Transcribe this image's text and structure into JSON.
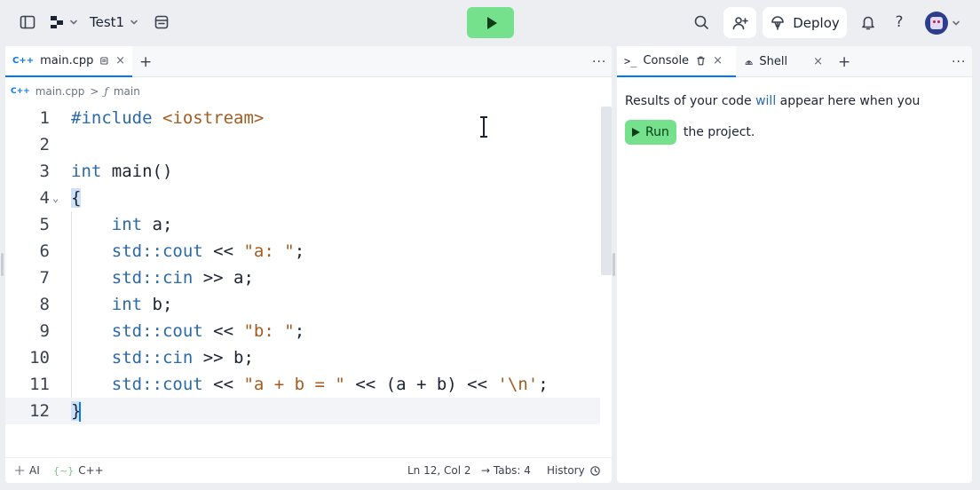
{
  "topbar": {
    "project_name": "Test1",
    "deploy_label": "Deploy",
    "help_label": "?"
  },
  "editor": {
    "tab_label": "main.cpp",
    "tab_close": "×",
    "add_tab": "+",
    "more": "···",
    "breadcrumb_file": "main.cpp",
    "breadcrumb_sep": ">",
    "breadcrumb_symbol_icon": "ƒ",
    "breadcrumb_symbol": "main",
    "lines": [
      {
        "n": "1",
        "parts": [
          [
            "kw",
            "#include"
          ],
          [
            "",
            " "
          ],
          [
            "str",
            "<iostream>"
          ]
        ]
      },
      {
        "n": "2",
        "parts": []
      },
      {
        "n": "3",
        "parts": [
          [
            "kw",
            "int"
          ],
          [
            "",
            " main()"
          ]
        ]
      },
      {
        "n": "4",
        "parts": [
          [
            "brace",
            "{"
          ]
        ]
      },
      {
        "n": "5",
        "parts": [
          [
            "",
            "    "
          ],
          [
            "kw",
            "int"
          ],
          [
            "",
            " a;"
          ]
        ]
      },
      {
        "n": "6",
        "parts": [
          [
            "",
            "    "
          ],
          [
            "kw",
            "std::cout"
          ],
          [
            "",
            " << "
          ],
          [
            "str",
            "\"a: \""
          ],
          [
            "",
            ";"
          ]
        ]
      },
      {
        "n": "7",
        "parts": [
          [
            "",
            "    "
          ],
          [
            "kw",
            "std::cin"
          ],
          [
            "",
            " >> a;"
          ]
        ]
      },
      {
        "n": "8",
        "parts": [
          [
            "",
            "    "
          ],
          [
            "kw",
            "int"
          ],
          [
            "",
            " b;"
          ]
        ]
      },
      {
        "n": "9",
        "parts": [
          [
            "",
            "    "
          ],
          [
            "kw",
            "std::cout"
          ],
          [
            "",
            " << "
          ],
          [
            "str",
            "\"b: \""
          ],
          [
            "",
            ";"
          ]
        ]
      },
      {
        "n": "10",
        "parts": [
          [
            "",
            "    "
          ],
          [
            "kw",
            "std::cin"
          ],
          [
            "",
            " >> b;"
          ]
        ]
      },
      {
        "n": "11",
        "parts": [
          [
            "",
            "    "
          ],
          [
            "kw",
            "std::cout"
          ],
          [
            "",
            " << "
          ],
          [
            "str",
            "\"a + b = \""
          ],
          [
            "",
            " << (a + b) << "
          ],
          [
            "str",
            "'\\n'"
          ],
          [
            "",
            ";"
          ]
        ]
      },
      {
        "n": "12",
        "parts": [
          [
            "brace",
            "}"
          ],
          [
            "caret",
            ""
          ]
        ]
      }
    ],
    "fold_marker": "⌄"
  },
  "statusbar": {
    "ai_label": "AI",
    "lang_icon": "{~}",
    "lang_label": "C++",
    "position": "Ln 12, Col 2",
    "tabs": "→ Tabs: 4",
    "history": "History"
  },
  "console": {
    "tab_console": "Console",
    "tab_shell": "Shell",
    "close": "×",
    "add_tab": "+",
    "more": "···",
    "msg_before": "Results of your code ",
    "msg_highlight": "will",
    "msg_after": " appear here when you",
    "run_label": "Run",
    "msg_end": "the project."
  },
  "colors": {
    "run_green": "#76e18c",
    "accent_blue": "#0079f2",
    "keyword": "#2a6aa8",
    "string": "#a55b1f"
  }
}
